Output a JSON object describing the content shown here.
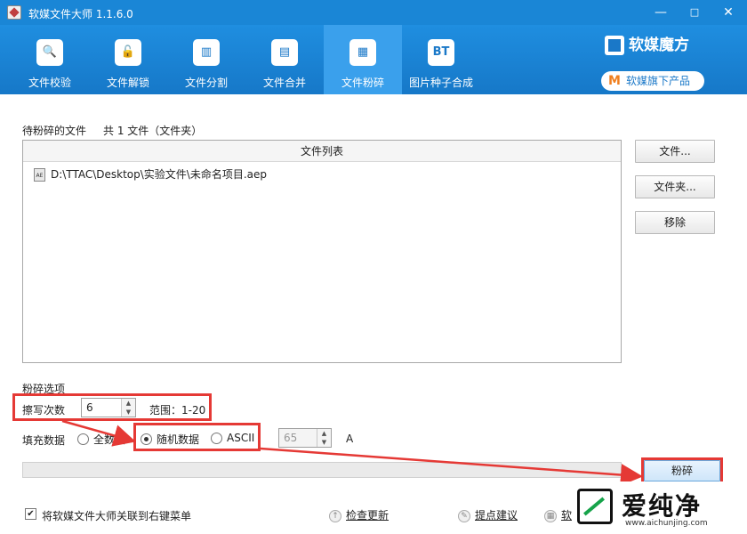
{
  "window": {
    "title": "软媒文件大师 1.1.6.0",
    "minimize_glyph": "—",
    "close_glyph": "✕"
  },
  "toolbar": {
    "tabs": [
      {
        "label": "文件校验",
        "icon": "magnifier-check-icon",
        "glyph": "🔍"
      },
      {
        "label": "文件解锁",
        "icon": "unlock-icon",
        "glyph": "🔓"
      },
      {
        "label": "文件分割",
        "icon": "split-file-icon",
        "glyph": "▥"
      },
      {
        "label": "文件合并",
        "icon": "merge-file-icon",
        "glyph": "▤"
      },
      {
        "label": "文件粉碎",
        "icon": "shredder-icon",
        "glyph": "▦",
        "active": true
      },
      {
        "label": "图片种子合成",
        "icon": "bt-icon",
        "glyph": "BT"
      }
    ],
    "brand": "软媒魔方",
    "sub_brand": "软媒旗下产品",
    "sub_brand_glyph": "M"
  },
  "main": {
    "pending_label": "待粉碎的文件",
    "pending_count": "共 1 文件（文件夹）",
    "list_header": "文件列表",
    "files": [
      {
        "path": "D:\\TTAC\\Desktop\\实验文件\\未命名项目.aep",
        "icon_text": "AE"
      }
    ],
    "buttons": {
      "file": "文件...",
      "folder": "文件夹...",
      "remove": "移除"
    }
  },
  "options": {
    "section_label": "粉碎选项",
    "erase_label": "擦写次数",
    "erase_value": "6",
    "range_label": "范围：1-20",
    "fill_label": "填充数据",
    "fill_options": [
      {
        "label": "全数据",
        "selected": false
      },
      {
        "label": "随机数据",
        "selected": true
      },
      {
        "label": "ASCII",
        "selected": false
      }
    ],
    "ascii_value": "65",
    "ascii_char": "A"
  },
  "actions": {
    "shred_button": "粉碎",
    "progress": 0
  },
  "footer": {
    "context_menu_label": "将软媒文件大师关联到右键菜单",
    "context_menu_checked": true,
    "check_update": "检查更新",
    "suggest": "提点建议",
    "more": "软"
  },
  "watermark": {
    "text": "爱纯净",
    "url": "www.aichunjing.com"
  },
  "colors": {
    "titlebar": "#1a86d6",
    "toolbar": "#1a80d0",
    "highlight": "#e53935"
  }
}
